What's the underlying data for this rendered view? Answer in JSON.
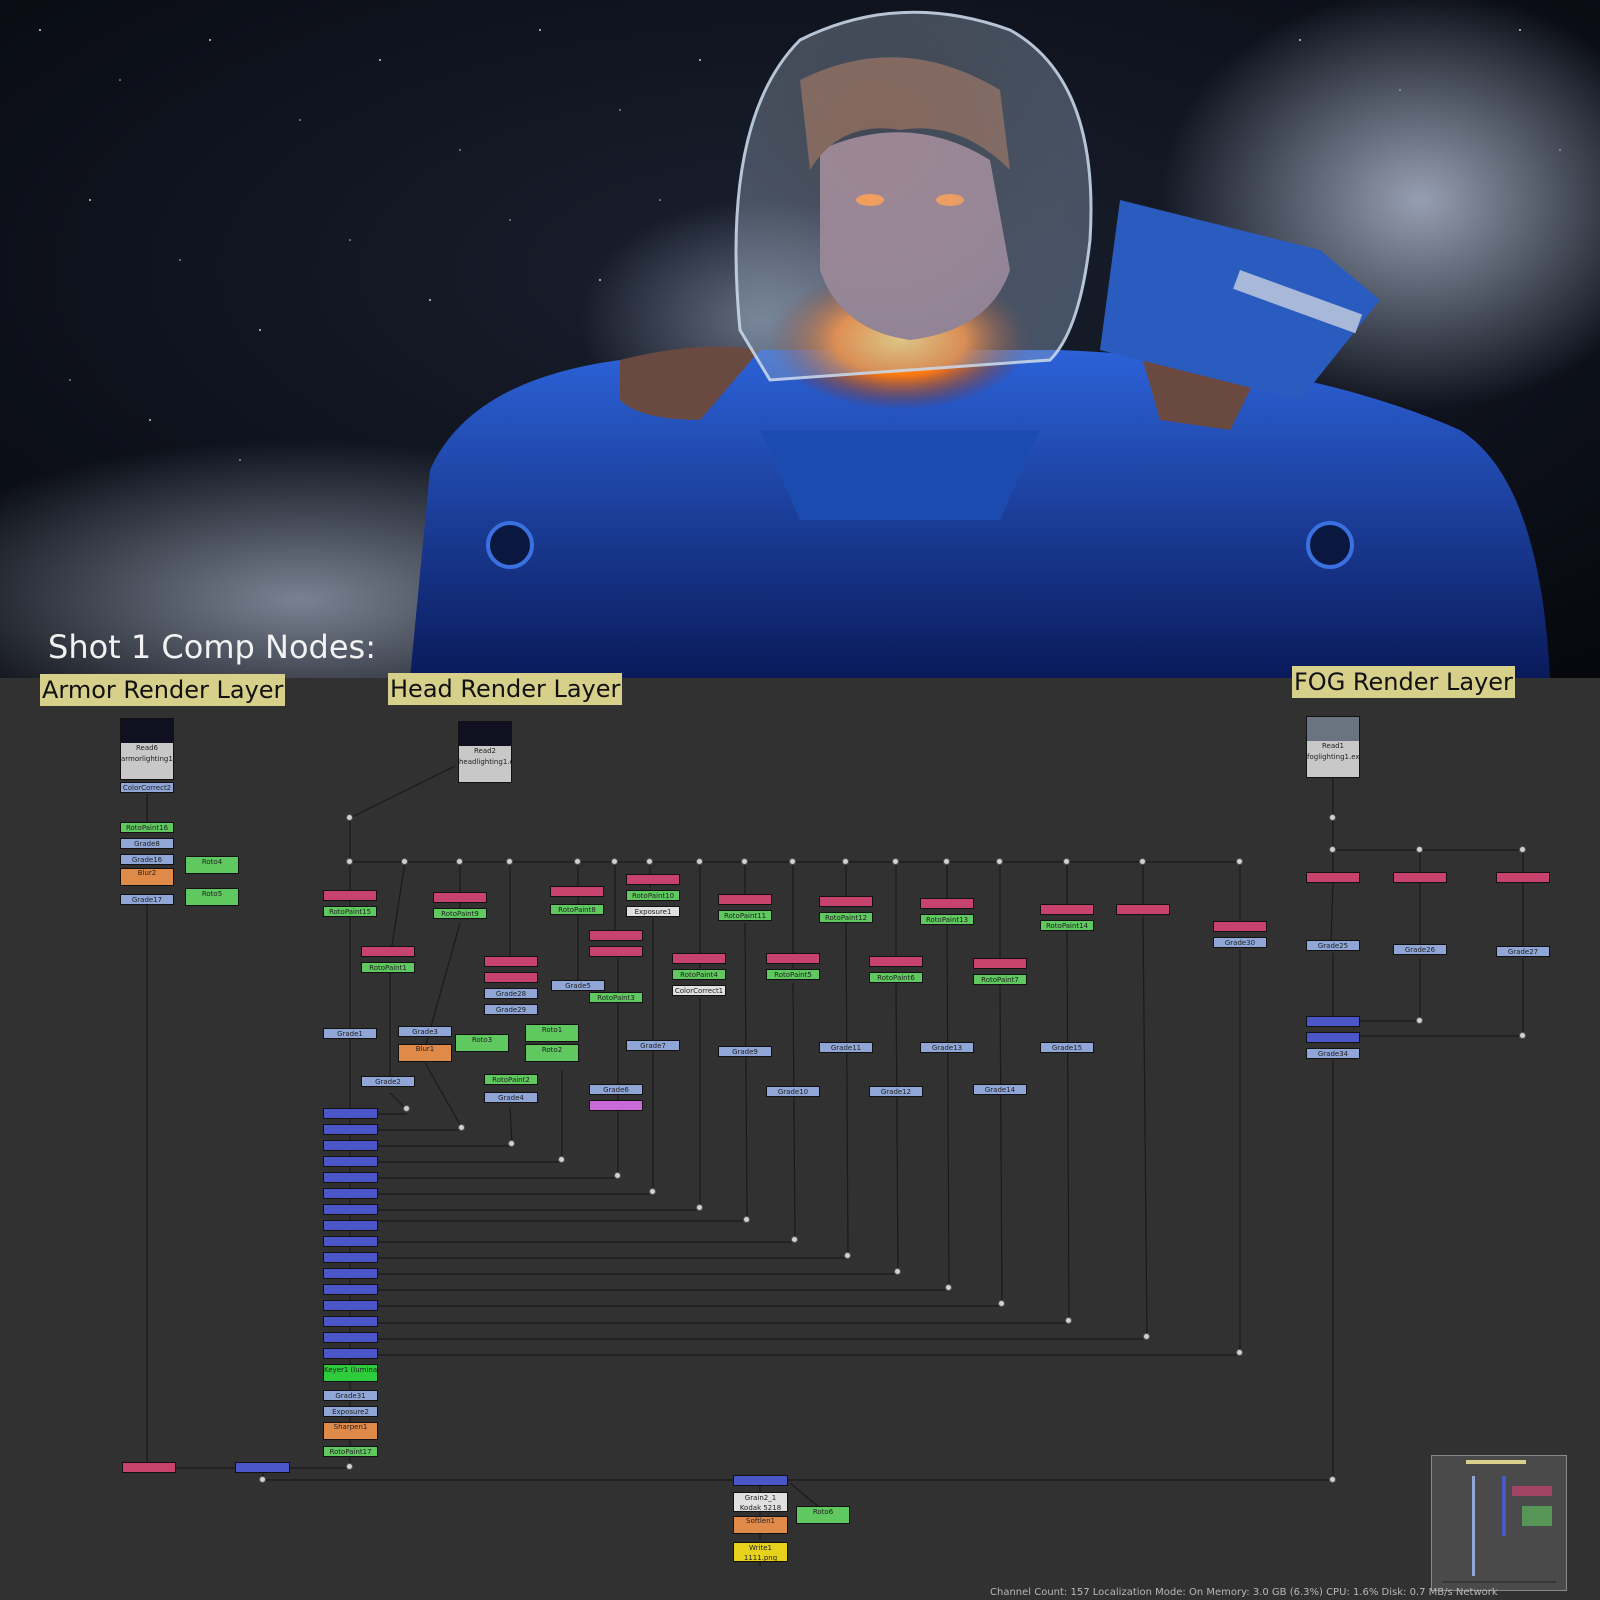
{
  "render": {
    "title": "Shot 1 Comp Nodes:"
  },
  "backdrops": [
    {
      "label": "Armor Render Layer"
    },
    {
      "label": "Head Render Layer"
    },
    {
      "label": "FOG Render Layer"
    }
  ],
  "reads": [
    {
      "name": "Read6",
      "file": "armorlighting1.exr"
    },
    {
      "name": "Read2",
      "file": "headlighting1.exr"
    },
    {
      "name": "Read1",
      "file": "foglighting1.exr"
    }
  ],
  "armor_nodes": [
    "ColorCorrect2",
    "RotoPaint16",
    "Grade8",
    "Grade16",
    "Blur2",
    "Grade17",
    "Roto4",
    "Roto5"
  ],
  "head_nodes": {
    "grades": [
      "Grade1",
      "Grade2",
      "Grade3",
      "Grade4",
      "Grade5",
      "Grade6",
      "Grade7",
      "Grade9",
      "Grade10",
      "Grade11",
      "Grade12",
      "Grade13",
      "Grade14",
      "Grade15",
      "Grade28",
      "Grade29",
      "Grade30",
      "Grade31"
    ],
    "rotopaints": [
      "RotoPaint1",
      "RotoPaint2",
      "RotoPaint3",
      "RotoPaint4",
      "RotoPaint5",
      "RotoPaint6",
      "RotoPaint7",
      "RotoPaint8",
      "RotoPaint9",
      "RotoPaint10",
      "RotoPaint11",
      "RotoPaint12",
      "RotoPaint13",
      "RotoPaint14",
      "RotoPaint15",
      "RotoPaint17"
    ],
    "rotos": [
      "Roto1",
      "Roto2",
      "Roto3"
    ],
    "others": [
      "Blur1",
      "Exposure1",
      "Exposure2",
      "Keyer1 (luminance key)",
      "ColorCorrect1",
      "Sharpen1"
    ]
  },
  "fog_nodes": [
    "Grade25",
    "Grade26",
    "Grade27",
    "Grade34"
  ],
  "output_nodes": [
    "Grain2_1",
    "Softlen1",
    "Roto6",
    "Write1"
  ],
  "output_sub": {
    "grain": "Kodak 5218",
    "write": "1111.png"
  },
  "status": {
    "text": "Channel Count: 157 Localization Mode: On Memory: 3.0 GB (6.3%) CPU: 1.6% Disk: 0.7 MB/s Network"
  },
  "colors": {
    "grade": "#8fa6d6",
    "roto": "#5fc85f",
    "shuffle": "#c8426e",
    "merge": "#4b56c8",
    "backdrop": "#d6d08a",
    "graph_bg": "#313131"
  }
}
